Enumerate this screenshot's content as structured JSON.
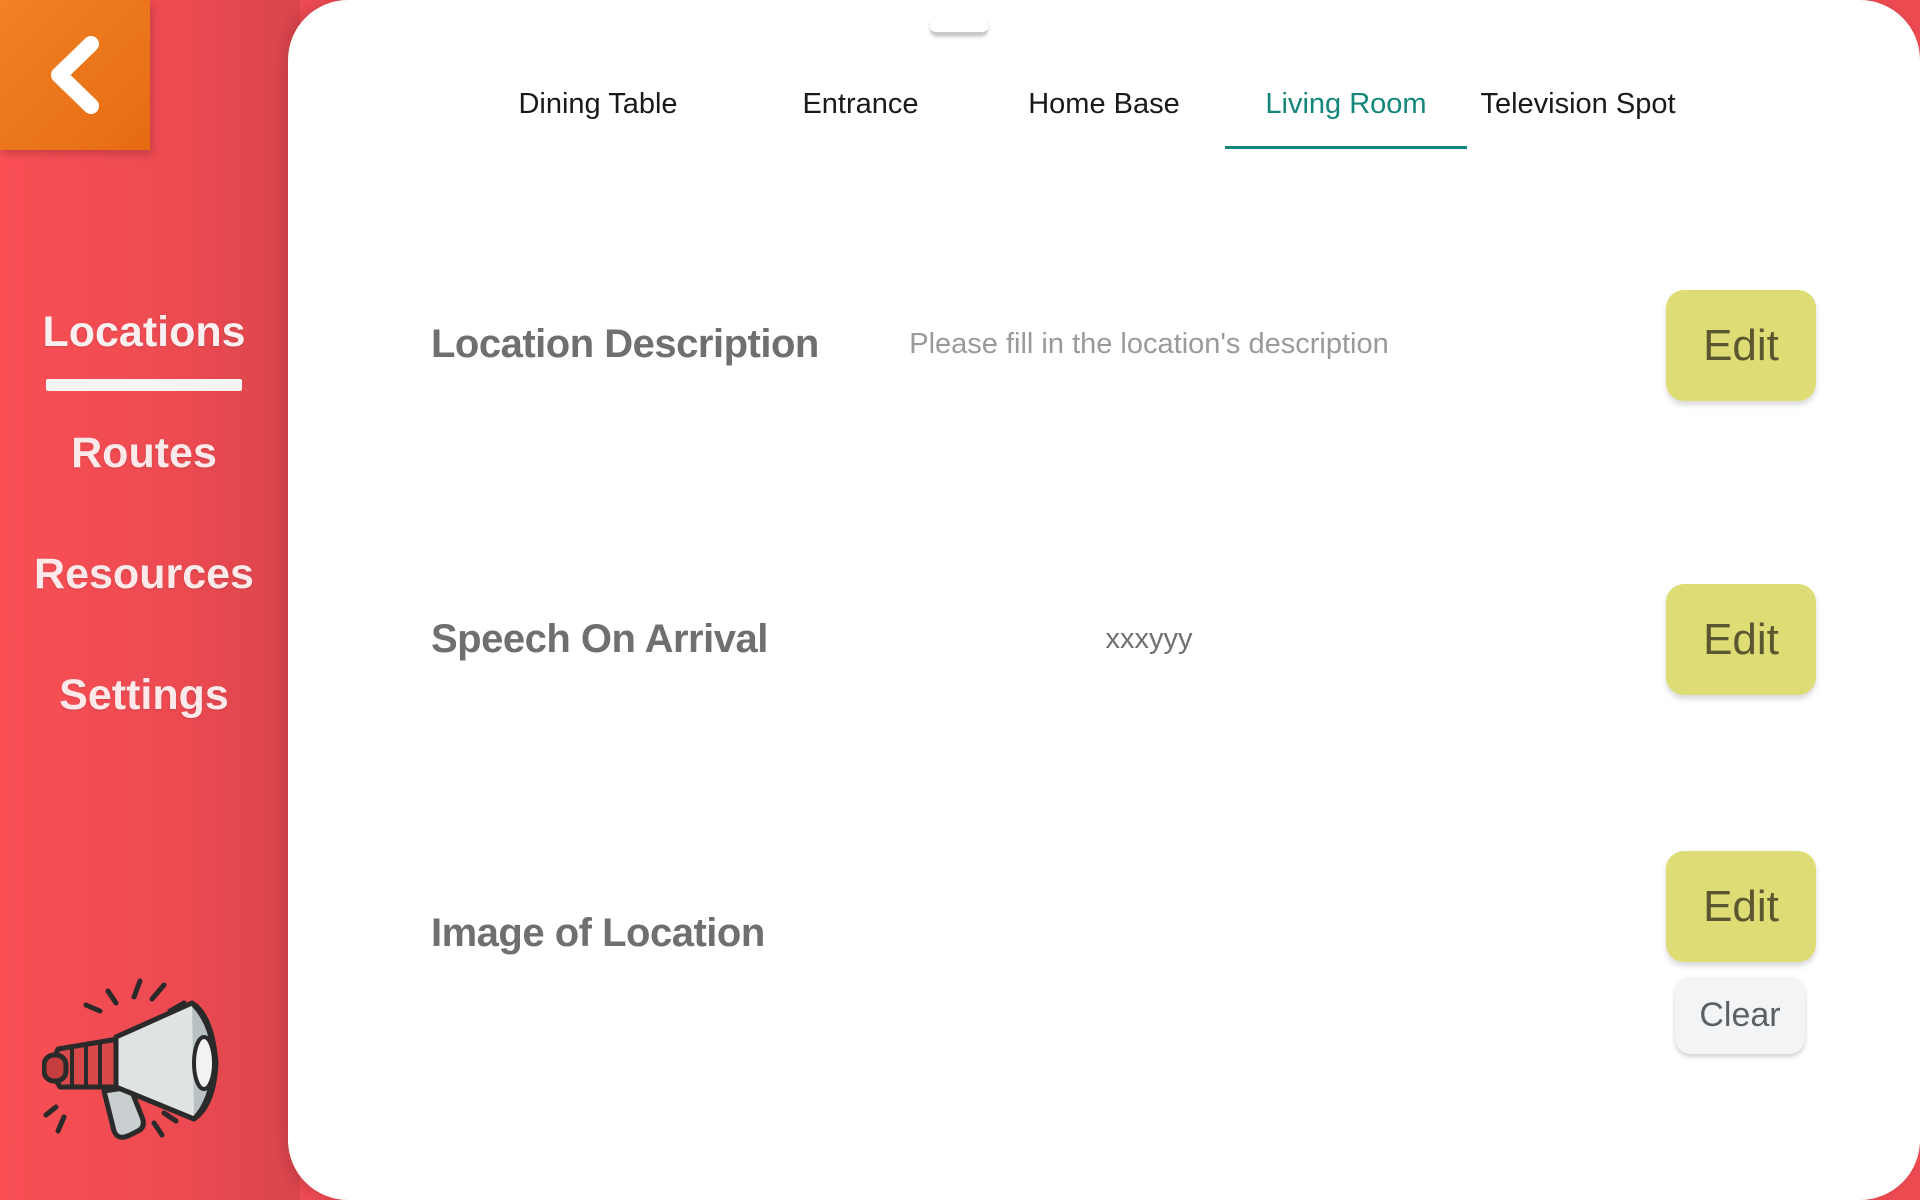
{
  "sidebar": {
    "back_icon": "chevron-left-icon",
    "items": [
      {
        "label": "Locations",
        "active": true
      },
      {
        "label": "Routes",
        "active": false
      },
      {
        "label": "Resources",
        "active": false
      },
      {
        "label": "Settings",
        "active": false
      }
    ],
    "footer_icon": "megaphone-icon",
    "accent_color": "#f04b52",
    "back_button_color": "#ef7a1f"
  },
  "tabs": [
    {
      "label": "Dining Table",
      "active": false
    },
    {
      "label": "Entrance",
      "active": false
    },
    {
      "label": "Home Base",
      "active": false
    },
    {
      "label": "Living Room",
      "active": true
    },
    {
      "label": "Television Spot",
      "active": false
    }
  ],
  "tab_active_color": "#15877a",
  "rows": [
    {
      "label": "Location Description",
      "value": "Please fill in the location's description",
      "edit_label": "Edit"
    },
    {
      "label": "Speech On Arrival",
      "value": "xxxyyy",
      "edit_label": "Edit"
    },
    {
      "label": "Image of Location",
      "value": "",
      "edit_label": "Edit",
      "clear_label": "Clear"
    }
  ],
  "edit_button_color": "#dedc74"
}
